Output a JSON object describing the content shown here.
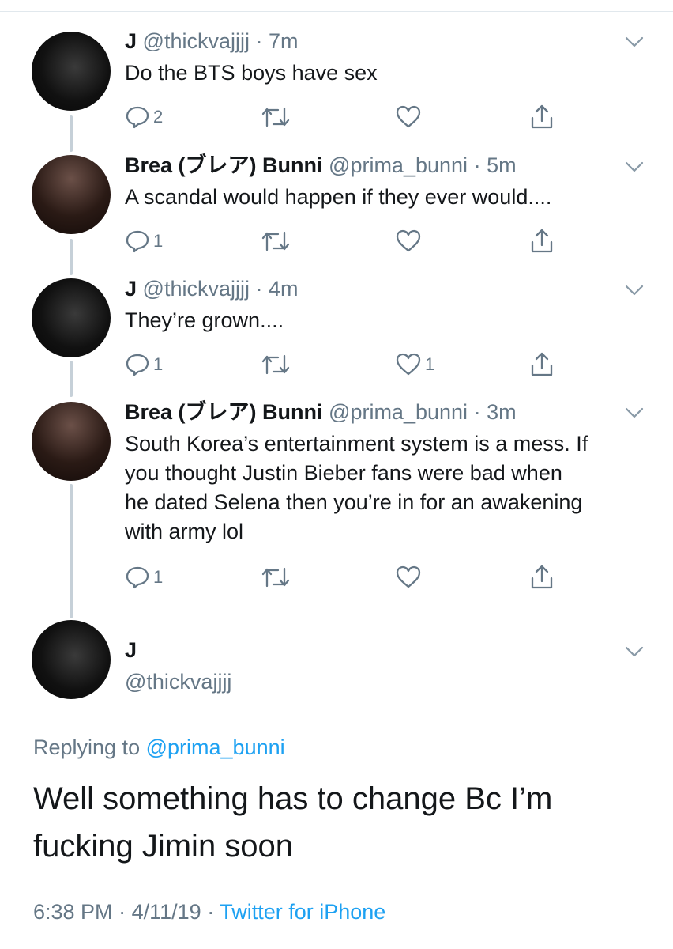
{
  "tweets": [
    {
      "name": "J",
      "handle": "@thickvajjjj",
      "dot": "·",
      "time": "7m",
      "text": "Do the BTS boys have sex",
      "replies": "2",
      "retweets": "",
      "likes": ""
    },
    {
      "name": "Brea (ブレア) Bunni",
      "handle": "@prima_bunni",
      "dot": "·",
      "time": "5m",
      "text": "A scandal would happen if they ever would....",
      "replies": "1",
      "retweets": "",
      "likes": ""
    },
    {
      "name": "J",
      "handle": "@thickvajjjj",
      "dot": "·",
      "time": "4m",
      "text": "They’re grown....",
      "replies": "1",
      "retweets": "",
      "likes": "1"
    },
    {
      "name": "Brea (ブレア) Bunni",
      "handle": "@prima_bunni",
      "dot": "·",
      "time": "3m",
      "text_lines": [
        "South Korea’s entertainment system is a mess. If",
        "you thought Justin Bieber fans were bad when",
        "he dated Selena then you’re in for an awakening",
        "with army lol"
      ],
      "replies": "1",
      "retweets": "",
      "likes": ""
    }
  ],
  "main_tweet": {
    "name": "J",
    "handle": "@thickvajjjj",
    "replying_prefix": "Replying to",
    "replying_handle": "@prima_bunni",
    "text_lines": [
      "Well something has to change Bc I’m",
      "fucking Jimin soon"
    ],
    "time": "6:38 PM",
    "sep1": "·",
    "date": "4/11/19",
    "sep2": "·",
    "source": "Twitter for iPhone"
  },
  "icons": {
    "reply": "reply-icon",
    "retweet": "retweet-icon",
    "like": "heart-icon",
    "share": "share-icon",
    "more": "chevron-down-icon"
  },
  "colors": {
    "text": "#14171a",
    "muted": "#657786",
    "link": "#1da1f2",
    "thread_line": "#c6d0d8"
  }
}
